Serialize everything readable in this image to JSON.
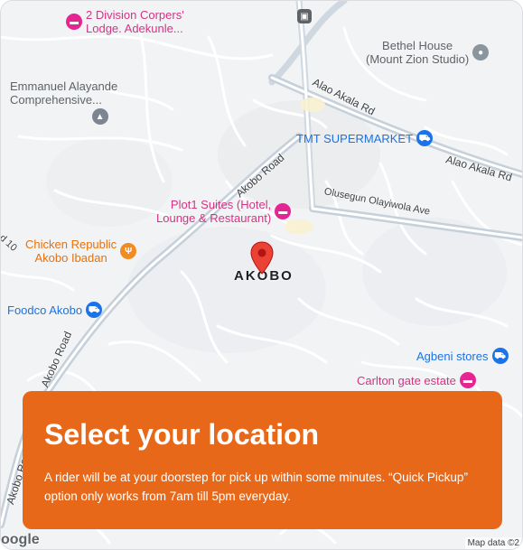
{
  "map": {
    "place_label": "AKOBO",
    "colors": {
      "background": "#f1f3f4",
      "street": "#ffffff",
      "arterial": "#c7d2dc",
      "pin": "#ea4335"
    },
    "pois": {
      "division": {
        "line1": "2 Division Corpers'",
        "line2": "Lodge. Adekunle...",
        "icon": "hotel-icon"
      },
      "bethel": {
        "line1": "Bethel House",
        "line2": "(Mount Zion Studio)",
        "icon": "place-icon"
      },
      "emmanuel": {
        "line1": "Emmanuel Alayande",
        "line2": "Comprehensive...",
        "icon": "school-icon"
      },
      "tmt": {
        "line1": "TMT SUPERMARKET",
        "icon": "shopping-cart-icon"
      },
      "plot1": {
        "line1": "Plot1 Suites (Hotel,",
        "line2": "Lounge & Restaurant)",
        "icon": "hotel-icon"
      },
      "chicken": {
        "line1": "Chicken Republic",
        "line2": "Akobo Ibadan",
        "icon": "restaurant-icon"
      },
      "foodco": {
        "line1": "Foodco Akobo",
        "icon": "shopping-cart-icon"
      },
      "agbeni": {
        "line1": "Agbeni stores",
        "icon": "shopping-cart-icon"
      },
      "carlton": {
        "line1": "Carlton gate estate",
        "icon": "hotel-icon"
      }
    },
    "roads": {
      "alao1": "Alao Akala Rd",
      "alao2": "Alao Akala Rd",
      "akobo_road_1": "Akobo Road",
      "akobo_road_2": "Akobo Road",
      "akobo_road_3": "Akobo Road",
      "olusegun": "Olusegun Olayiwola Ave",
      "rd10": "d 10"
    },
    "google_logo": "oogle",
    "map_data": "Map data ©2"
  },
  "card": {
    "title": "Select your location",
    "body": "A rider will be at your doorstep for pick up within some minutes. “Quick Pickup” option only works from 7am till 5pm everyday.",
    "background": "#e8681a"
  }
}
